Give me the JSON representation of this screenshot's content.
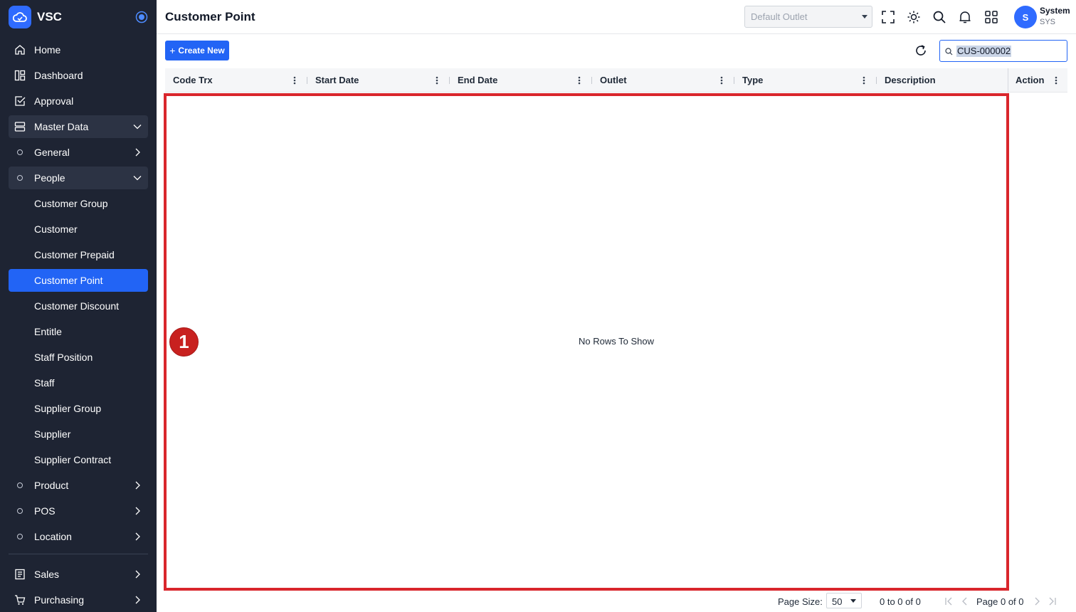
{
  "app": {
    "name": "VSC"
  },
  "sidebar": {
    "items": [
      {
        "label": "Home"
      },
      {
        "label": "Dashboard"
      },
      {
        "label": "Approval"
      },
      {
        "label": "Master Data"
      },
      {
        "label": "General"
      },
      {
        "label": "People"
      },
      {
        "label": "Customer Group"
      },
      {
        "label": "Customer"
      },
      {
        "label": "Customer Prepaid"
      },
      {
        "label": "Customer Point"
      },
      {
        "label": "Customer Discount"
      },
      {
        "label": "Entitle"
      },
      {
        "label": "Staff Position"
      },
      {
        "label": "Staff"
      },
      {
        "label": "Supplier Group"
      },
      {
        "label": "Supplier"
      },
      {
        "label": "Supplier Contract"
      },
      {
        "label": "Product"
      },
      {
        "label": "POS"
      },
      {
        "label": "Location"
      },
      {
        "label": "Sales"
      },
      {
        "label": "Purchasing"
      }
    ]
  },
  "header": {
    "title": "Customer Point",
    "outlet_placeholder": "Default Outlet",
    "user": {
      "name": "System",
      "code": "SYS",
      "initial": "S"
    }
  },
  "toolbar": {
    "create_label": "Create New",
    "search_value": "CUS-000002"
  },
  "grid": {
    "columns": [
      "Code Trx",
      "Start Date",
      "End Date",
      "Outlet",
      "Type",
      "Description"
    ],
    "action_column": "Action",
    "empty_message": "No Rows To Show",
    "annotation": "1"
  },
  "pager": {
    "page_size_label": "Page Size:",
    "page_size": "50",
    "range": "0 to 0 of 0",
    "page_info": "Page 0 of 0"
  },
  "colors": {
    "sidebar_bg": "#1e2433",
    "accent": "#2264f5",
    "highlight": "#d9262c"
  }
}
